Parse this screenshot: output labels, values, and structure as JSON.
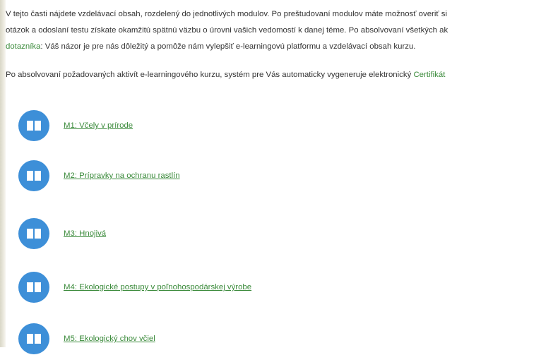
{
  "intro": {
    "line1": "V tejto časti nájdete vzdelávací obsah, rozdelený do jednotlivých modulov. Po preštudovaní modulov máte možnosť overiť si",
    "line2": "otázok a odoslaní testu získate okamžitú spätnú väzbu o úrovni vašich vedomostí k danej téme. Po absolvovaní všetkých ak",
    "line3_link": "dotazníka",
    "line3_rest": ": Váš názor je pre nás dôležitý a pomôže nám vylepšiť e-learningovú platformu a vzdelávací obsah kurzu.",
    "line4_text": "Po absolvovaní požadovaných aktivít e-learningového kurzu, systém pre Vás automaticky vygeneruje elektronický ",
    "line4_link": "Certifikát"
  },
  "modules": [
    {
      "label": "M1: Včely v prírode"
    },
    {
      "label": "M2: Prípravky na ochranu rastlín"
    },
    {
      "label": "M3: Hnojivá"
    },
    {
      "label": "M4: Ekologické postupy v poľnohospodárskej výrobe"
    },
    {
      "label": "M5: Ekologický chov včiel"
    }
  ],
  "colors": {
    "link": "#3a8a3a",
    "icon_circle": "#3d8fd8",
    "text": "#333333"
  },
  "icons": {
    "module_icon": "book-icon"
  }
}
